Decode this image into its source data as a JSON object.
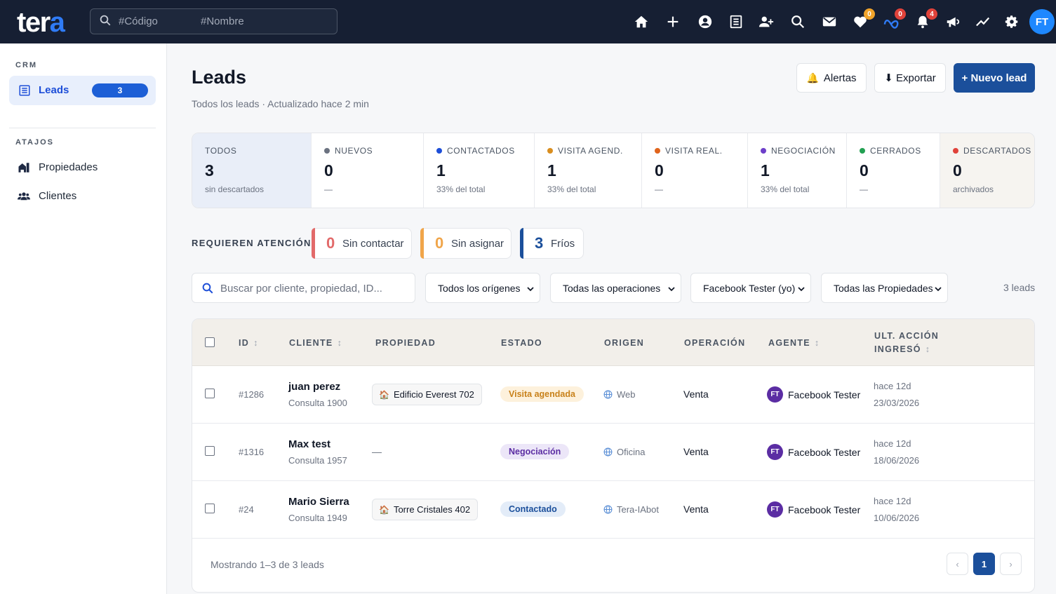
{
  "brand": {
    "logo_part1": "ter",
    "logo_part2": "a"
  },
  "top_search": {
    "placeholder_code": "#Código",
    "placeholder_name": "#Nombre"
  },
  "top_icons": [
    {
      "name": "home-icon"
    },
    {
      "name": "plus-icon"
    },
    {
      "name": "user-circle-icon"
    },
    {
      "name": "list-icon"
    },
    {
      "name": "users-add-icon"
    },
    {
      "name": "search-icon"
    },
    {
      "name": "mail-icon"
    },
    {
      "name": "heart-icon",
      "badge": "0"
    },
    {
      "name": "meta-icon",
      "badge": "0"
    },
    {
      "name": "bell-icon",
      "badge": "4"
    },
    {
      "name": "megaphone-icon"
    },
    {
      "name": "trend-icon"
    },
    {
      "name": "gear-icon"
    }
  ],
  "user_avatar": "FT",
  "sidebar": {
    "section_crm": "CRM",
    "active_item": {
      "label": "Leads",
      "count": "3"
    },
    "section_shortcuts": "ATAJOS",
    "links": [
      {
        "label": "Propiedades"
      },
      {
        "label": "Clientes"
      }
    ]
  },
  "header": {
    "title": "Leads",
    "subtitle": "Todos los leads · Actualizado hace 2 min",
    "alerts_btn": "Alertas",
    "export_btn": "⬇ Exportar",
    "new_btn": "+ Nuevo lead"
  },
  "stats": [
    {
      "label": "TODOS",
      "value": "3",
      "note": "sin descartados",
      "dot": ""
    },
    {
      "label": "NUEVOS",
      "value": "0",
      "note": "—",
      "dot": "#6b7280"
    },
    {
      "label": "CONTACTADOS",
      "value": "1",
      "note": "33% del total",
      "dot": "#1d4ed8"
    },
    {
      "label": "VISITA AGEND.",
      "value": "1",
      "note": "33% del total",
      "dot": "#d98e1f"
    },
    {
      "label": "VISITA REAL.",
      "value": "0",
      "note": "—",
      "dot": "#e0641c"
    },
    {
      "label": "NEGOCIACIÓN",
      "value": "1",
      "note": "33% del total",
      "dot": "#6d3fc9"
    },
    {
      "label": "CERRADOS",
      "value": "0",
      "note": "—",
      "dot": "#22a052"
    },
    {
      "label": "DESCARTADOS",
      "value": "0",
      "note": "archivados",
      "dot": "#e0423a"
    }
  ],
  "attention": {
    "label": "REQUIEREN ATENCIÓN",
    "items": [
      {
        "num": "0",
        "text": "Sin contactar",
        "color": "#e26a6a"
      },
      {
        "num": "0",
        "text": "Sin asignar",
        "color": "#f0a54a"
      },
      {
        "num": "3",
        "text": "Fríos",
        "color": "#1b4f9b"
      }
    ]
  },
  "filters": {
    "search_placeholder": "Buscar por cliente, propiedad, ID...",
    "origin": "Todos los orígenes",
    "operation": "Todas las operaciones",
    "agent": "Facebook Tester (yo)",
    "property": "Todas las Propiedades",
    "count": "3 leads"
  },
  "table": {
    "headers": {
      "id": "ID",
      "client": "CLIENTE",
      "property": "PROPIEDAD",
      "status": "ESTADO",
      "origin": "ORIGEN",
      "operation": "OPERACIÓN",
      "agent": "AGENTE",
      "last_action": "ULT. ACCIÓN",
      "ingreso": "INGRESÓ"
    },
    "rows": [
      {
        "id": "#1286",
        "name": "juan perez",
        "consulta": "Consulta 1900",
        "property": "Edificio Everest 702",
        "status": "Visita agendada",
        "status_bg": "#fdf1dc",
        "status_fg": "#c8811a",
        "origin": "Web",
        "operation": "Venta",
        "agent_initials": "FT",
        "agent": "Facebook Tester",
        "last": "hace 12d",
        "date": "23/03/2026"
      },
      {
        "id": "#1316",
        "name": "Max test",
        "consulta": "Consulta 1957",
        "property": "—",
        "status": "Negociación",
        "status_bg": "#ece6f8",
        "status_fg": "#5b2da3",
        "origin": "Oficina",
        "operation": "Venta",
        "agent_initials": "FT",
        "agent": "Facebook Tester",
        "last": "hace 12d",
        "date": "18/06/2026"
      },
      {
        "id": "#24",
        "name": "Mario Sierra",
        "consulta": "Consulta 1949",
        "property": "Torre Cristales 402",
        "status": "Contactado",
        "status_bg": "#e3ecf8",
        "status_fg": "#1b4f9b",
        "origin": "Tera-IAbot",
        "operation": "Venta",
        "agent_initials": "FT",
        "agent": "Facebook Tester",
        "last": "hace 12d",
        "date": "10/06/2026"
      }
    ],
    "footer": "Mostrando 1–3 de 3 leads",
    "pagination": {
      "prev": "‹",
      "current": "1",
      "next": "›"
    }
  }
}
